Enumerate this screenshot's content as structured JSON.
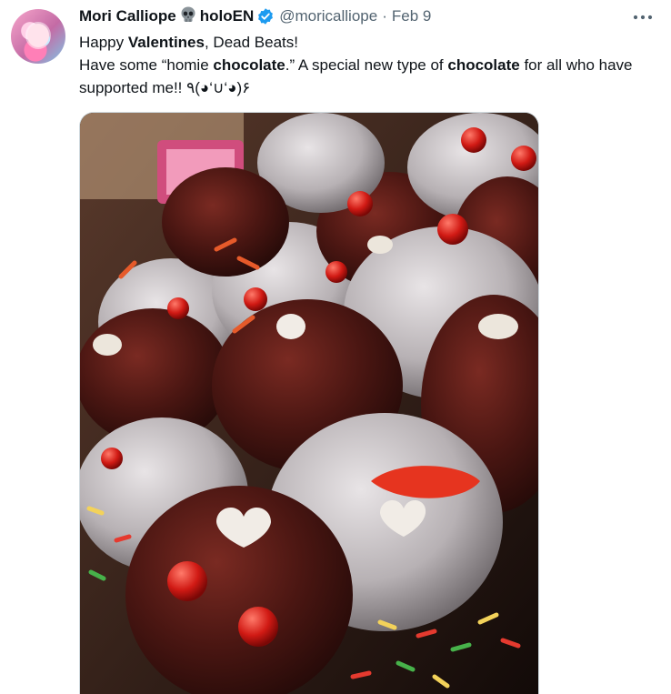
{
  "tweet": {
    "author_name": "Mori Calliope",
    "author_org": "holoEN",
    "handle": "@moricalliope",
    "separator": "·",
    "date": "Feb 9",
    "line1": {
      "pre": "Happy ",
      "bold": "Valentines",
      "post": ", Dead Beats!"
    },
    "line2": {
      "pre": "Have some “homie ",
      "bold1": "chocolate",
      "mid": ".” A special new type of ",
      "bold2": "chocolate",
      "post": " for all who have supported me!! ٩(◕‘∪‘◕)۶"
    }
  },
  "icons": {
    "skull": "skull-icon",
    "verified": "verified-badge-icon",
    "more": "more-options-icon"
  },
  "colors": {
    "text": "#0f1419",
    "secondary": "#536471",
    "verified": "#1d9bf0"
  }
}
